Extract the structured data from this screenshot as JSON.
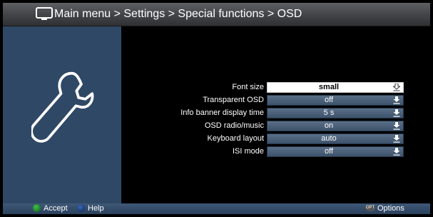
{
  "header": {
    "icon": "tv-icon",
    "breadcrumb": "Main menu > Settings > Special functions > OSD"
  },
  "left_panel": {
    "icon": "wrench-icon",
    "color": "#2f4865"
  },
  "settings": [
    {
      "label": "Font size",
      "value": "small",
      "selected": true
    },
    {
      "label": "Transparent OSD",
      "value": "off",
      "selected": false
    },
    {
      "label": "Info banner display time",
      "value": "5 s",
      "selected": false
    },
    {
      "label": "OSD radio/music",
      "value": "on",
      "selected": false
    },
    {
      "label": "Keyboard layout",
      "value": "auto",
      "selected": false
    },
    {
      "label": "ISI mode",
      "value": "off",
      "selected": false
    }
  ],
  "footer": {
    "accept_label": "Accept",
    "help_label": "Help",
    "options_badge": "OPT",
    "options_label": "Options",
    "accept_color": "#1f8a2a",
    "help_color": "#1f3f86"
  }
}
